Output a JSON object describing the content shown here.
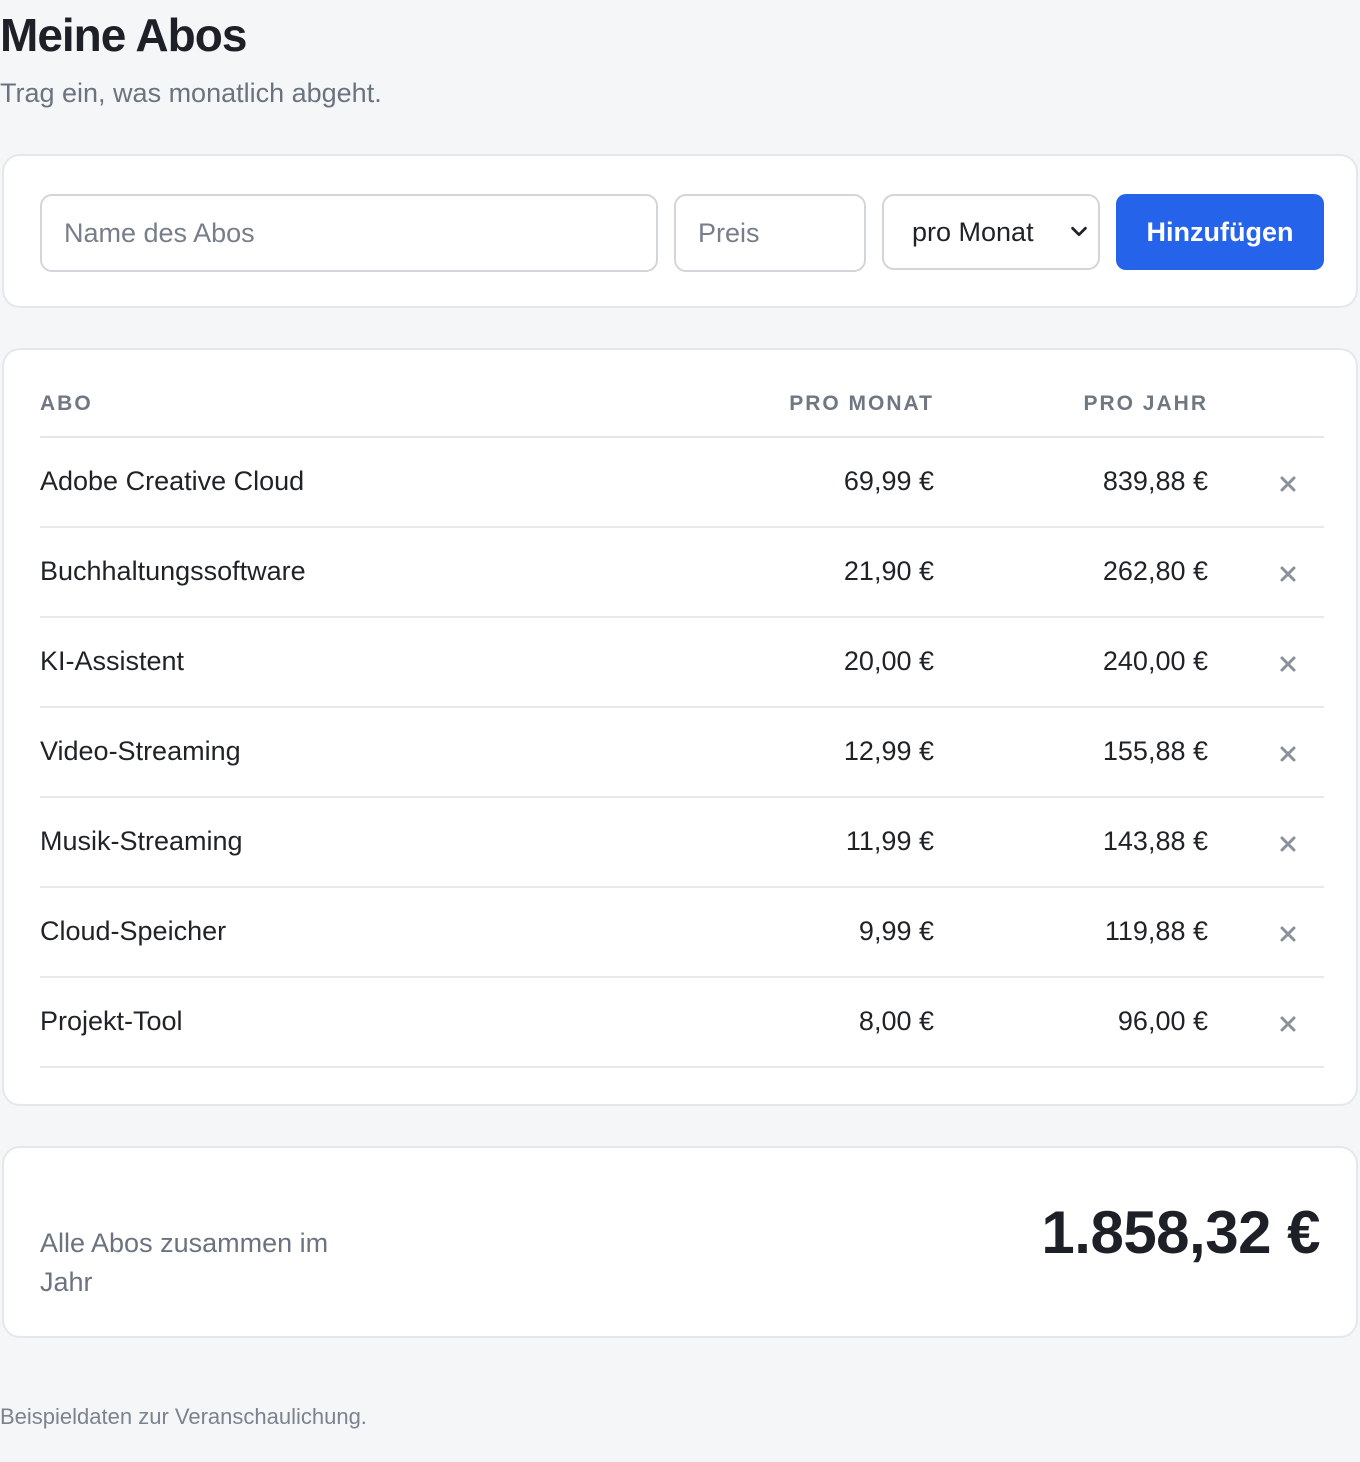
{
  "header": {
    "title": "Meine Abos",
    "subtitle": "Trag ein, was monatlich abgeht."
  },
  "form": {
    "name_placeholder": "Name des Abos",
    "price_placeholder": "Preis",
    "interval_selected": "pro Monat",
    "add_label": "Hinzufügen"
  },
  "table": {
    "headers": {
      "name": "ABO",
      "month": "PRO MONAT",
      "year": "PRO JAHR"
    },
    "rows": [
      {
        "name": "Adobe Creative Cloud",
        "month": "69,99 €",
        "year": "839,88 €"
      },
      {
        "name": "Buchhaltungssoftware",
        "month": "21,90 €",
        "year": "262,80 €"
      },
      {
        "name": "KI-Assistent",
        "month": "20,00 €",
        "year": "240,00 €"
      },
      {
        "name": "Video-Streaming",
        "month": "12,99 €",
        "year": "155,88 €"
      },
      {
        "name": "Musik-Streaming",
        "month": "11,99 €",
        "year": "143,88 €"
      },
      {
        "name": "Cloud-Speicher",
        "month": "9,99 €",
        "year": "119,88 €"
      },
      {
        "name": "Projekt-Tool",
        "month": "8,00 €",
        "year": "96,00 €"
      }
    ]
  },
  "total": {
    "label": "Alle Abos zusammen im Jahr",
    "value": "1.858,32 €"
  },
  "footnote": "Beispieldaten zur Veranschaulichung.",
  "colors": {
    "accent": "#2563eb",
    "background": "#f5f6f8",
    "muted_text": "#6b7380"
  },
  "icons": {
    "remove": "close-icon",
    "select_arrow": "chevron-down-icon"
  }
}
